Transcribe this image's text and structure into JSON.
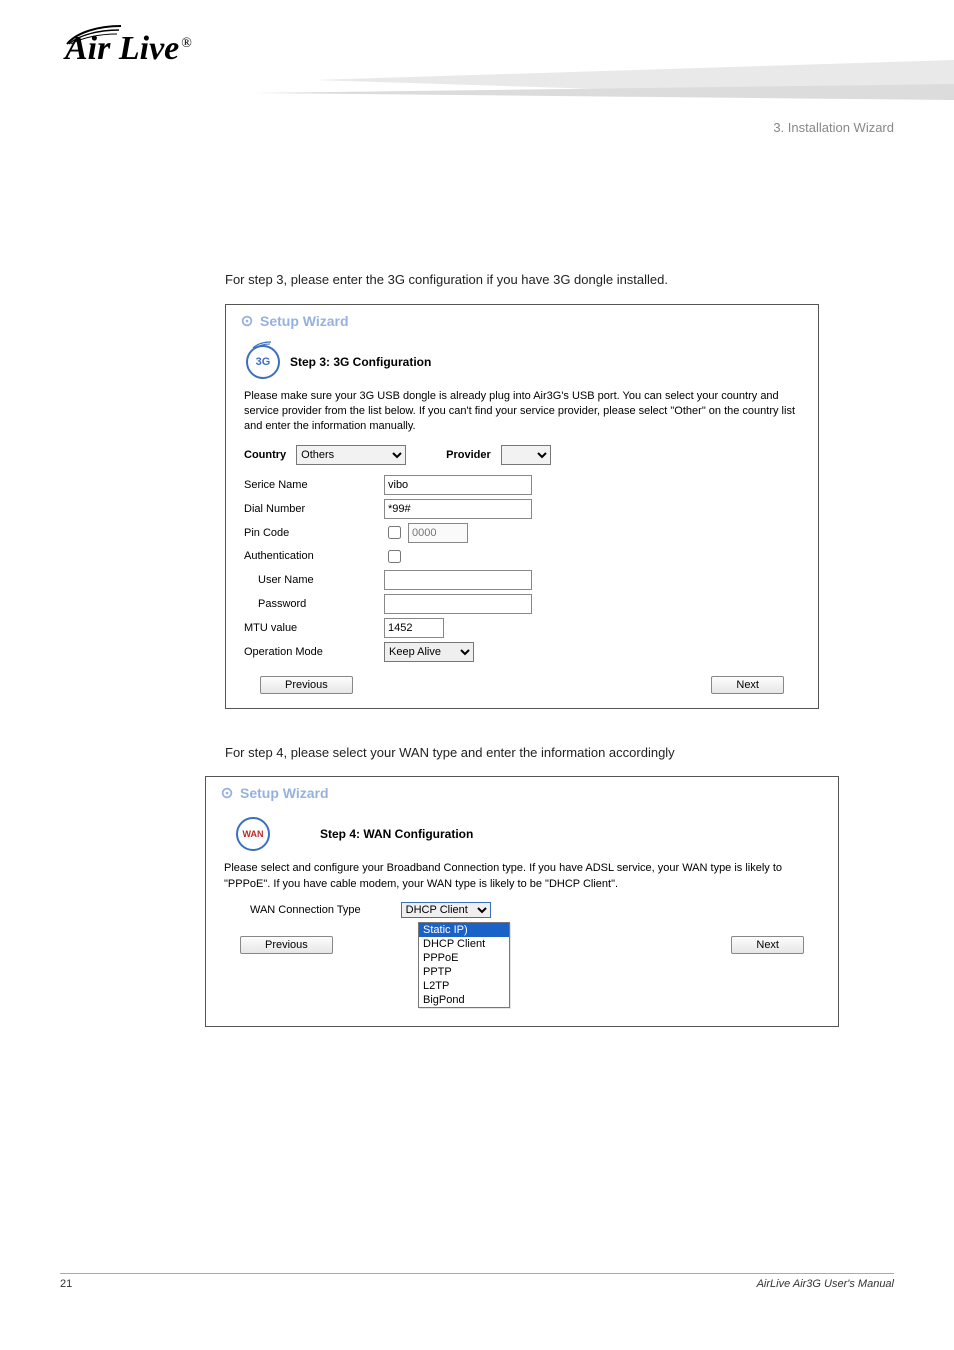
{
  "brand": {
    "logo_text": "Air Live",
    "regmark": "®"
  },
  "chapter": {
    "num": "3",
    "line1": "3. Installation Wizard"
  },
  "intro_text": "For step 3, please enter the 3G configuration if you have 3G dongle installed.",
  "wizard3": {
    "header": "Setup Wizard",
    "badge": "3G",
    "step_title": "Step 3: 3G Configuration",
    "desc": "Please make sure your 3G USB dongle is already plug into Air3G's USB port. You can select your country and service provider from the list below. If you can't find your service provider, please select \"Other\" on the country list and enter the information manually.",
    "country_label": "Country",
    "country_value": "Others",
    "provider_label": "Provider",
    "fields": {
      "service_name_label": "Serice Name",
      "service_name_value": "vibo",
      "dial_number_label": "Dial Number",
      "dial_number_value": "*99#",
      "pin_code_label": "Pin Code",
      "pin_code_placeholder": "0000",
      "authentication_label": "Authentication",
      "user_name_label": "User Name",
      "password_label": "Password",
      "mtu_label": "MTU value",
      "mtu_value": "1452",
      "operation_mode_label": "Operation Mode",
      "operation_mode_value": "Keep Alive"
    },
    "prev_label": "Previous",
    "next_label": "Next"
  },
  "intro_text_2": "For step 4, please select your WAN type and enter the information accordingly",
  "wizard4": {
    "header": "Setup Wizard",
    "badge": "WAN",
    "step_title": "Step 4: WAN Configuration",
    "desc": "Please select and configure your Broadband Connection type. If you have ADSL service, your WAN type is likely to \"PPPoE\". If you have cable modem, your WAN type is likely to be \"DHCP Client\".",
    "wan_label": "WAN Connection Type",
    "wan_value": "DHCP Client",
    "options": [
      "Static IP)",
      "DHCP Client",
      "PPPoE",
      "PPTP",
      "L2TP",
      "BigPond"
    ],
    "prev_label": "Previous",
    "next_label": "Next"
  },
  "footer": {
    "page_num": "21",
    "product": "AirLive Air3G User's Manual"
  }
}
